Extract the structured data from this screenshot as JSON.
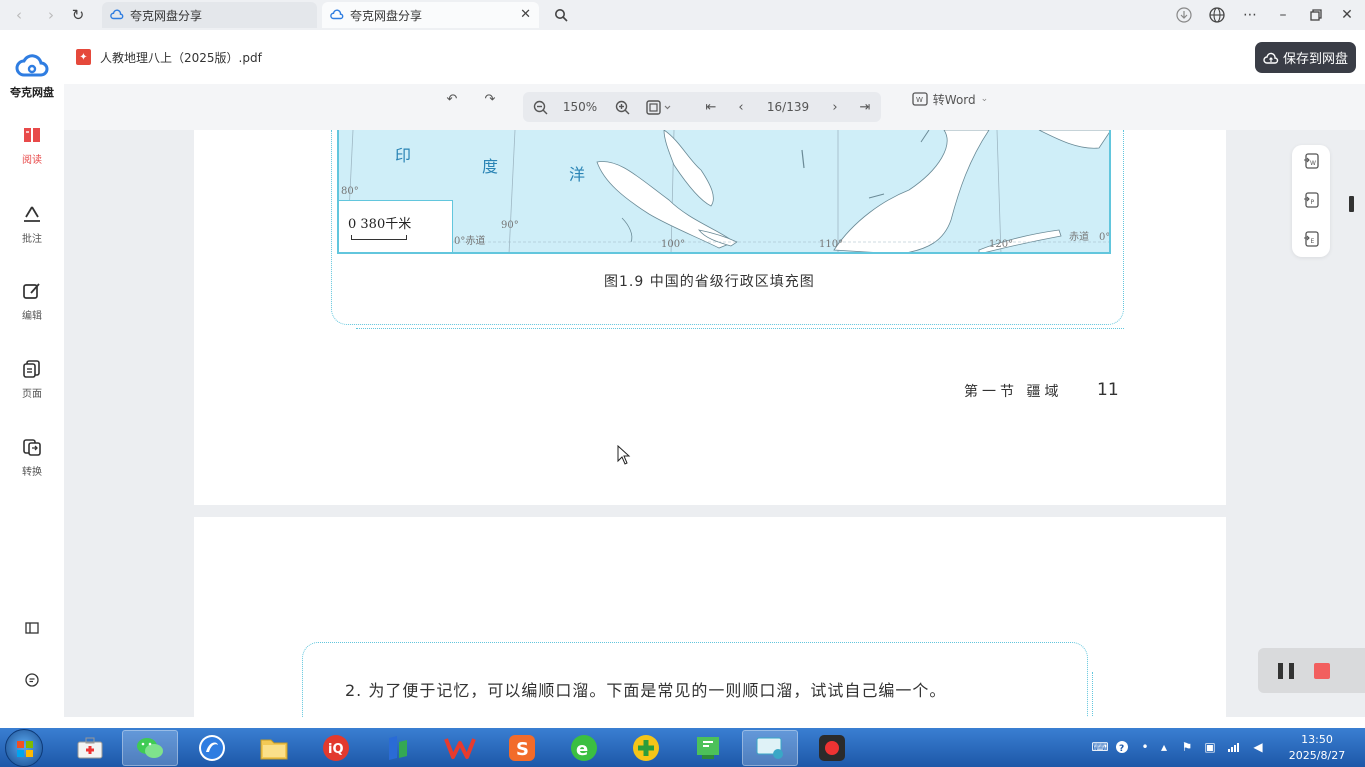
{
  "browser": {
    "tabs": [
      {
        "label": "夸克网盘分享"
      },
      {
        "label": "夸克网盘分享"
      }
    ]
  },
  "app": {
    "logo_text": "夸克网盘",
    "sidebar": [
      {
        "label": "阅读",
        "icon": "read-icon"
      },
      {
        "label": "批注",
        "icon": "annotate-icon"
      },
      {
        "label": "编辑",
        "icon": "edit-icon"
      },
      {
        "label": "页面",
        "icon": "pages-icon"
      },
      {
        "label": "转换",
        "icon": "convert-icon"
      }
    ],
    "file_name": "人教地理八上（2025版）.pdf",
    "save_button": "保存到网盘"
  },
  "toolbar": {
    "zoom": "150%",
    "page_indicator": "16/139",
    "convert_word": "转Word"
  },
  "document": {
    "map_labels": [
      "印",
      "度",
      "洋"
    ],
    "map_degrees": [
      "80°",
      "90°",
      "100°",
      "110°",
      "120°",
      "0°"
    ],
    "equator_label": "0°赤道",
    "equator_label_right": "赤道",
    "scale_text": "0      380千米",
    "figure_caption": "图1.9   中国的省级行政区填充图",
    "page_footer": "第一节  疆域",
    "page_number": "11",
    "paragraph": "2. 为了便于记忆，可以编顺口溜。下面是常见的一则顺口溜，试试自己编一个。"
  },
  "right_tools": [
    "to-word-icon",
    "to-ppt-icon",
    "to-excel-icon"
  ],
  "taskbar": {
    "time": "13:50",
    "date": "2025/8/27"
  },
  "colors": {
    "accent_red": "#e84a4a",
    "map_water": "#cfeef8",
    "map_border": "#62c6dd",
    "taskbar": "#2a6bbd"
  }
}
